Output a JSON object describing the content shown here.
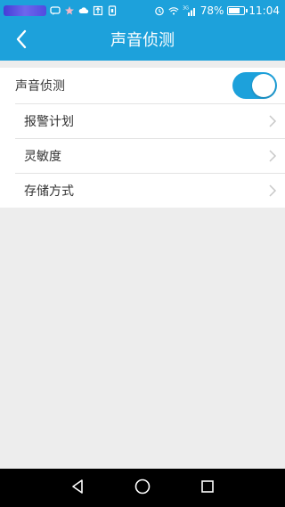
{
  "status_bar": {
    "signal_label": "3G",
    "battery_percent": "78%",
    "battery_level": 0.78,
    "time": "11:04",
    "icons": [
      "blurred-notification",
      "chat-icon",
      "star-icon",
      "cloud-icon",
      "upload-icon",
      "sim-icon",
      "alarm-icon",
      "wifi-icon",
      "signal-icon",
      "battery-icon"
    ]
  },
  "header": {
    "title": "声音侦测",
    "back_icon": "chevron-left-icon"
  },
  "settings": {
    "main_label": "声音侦测",
    "toggle_on": true,
    "items": [
      {
        "label": "报警计划"
      },
      {
        "label": "灵敏度"
      },
      {
        "label": "存储方式"
      }
    ]
  },
  "colors": {
    "accent": "#1da1db",
    "background": "#ededed",
    "nav_bar": "#000000"
  },
  "nav_bar": {
    "buttons": [
      "back-triangle-icon",
      "home-circle-icon",
      "recents-square-icon"
    ]
  }
}
